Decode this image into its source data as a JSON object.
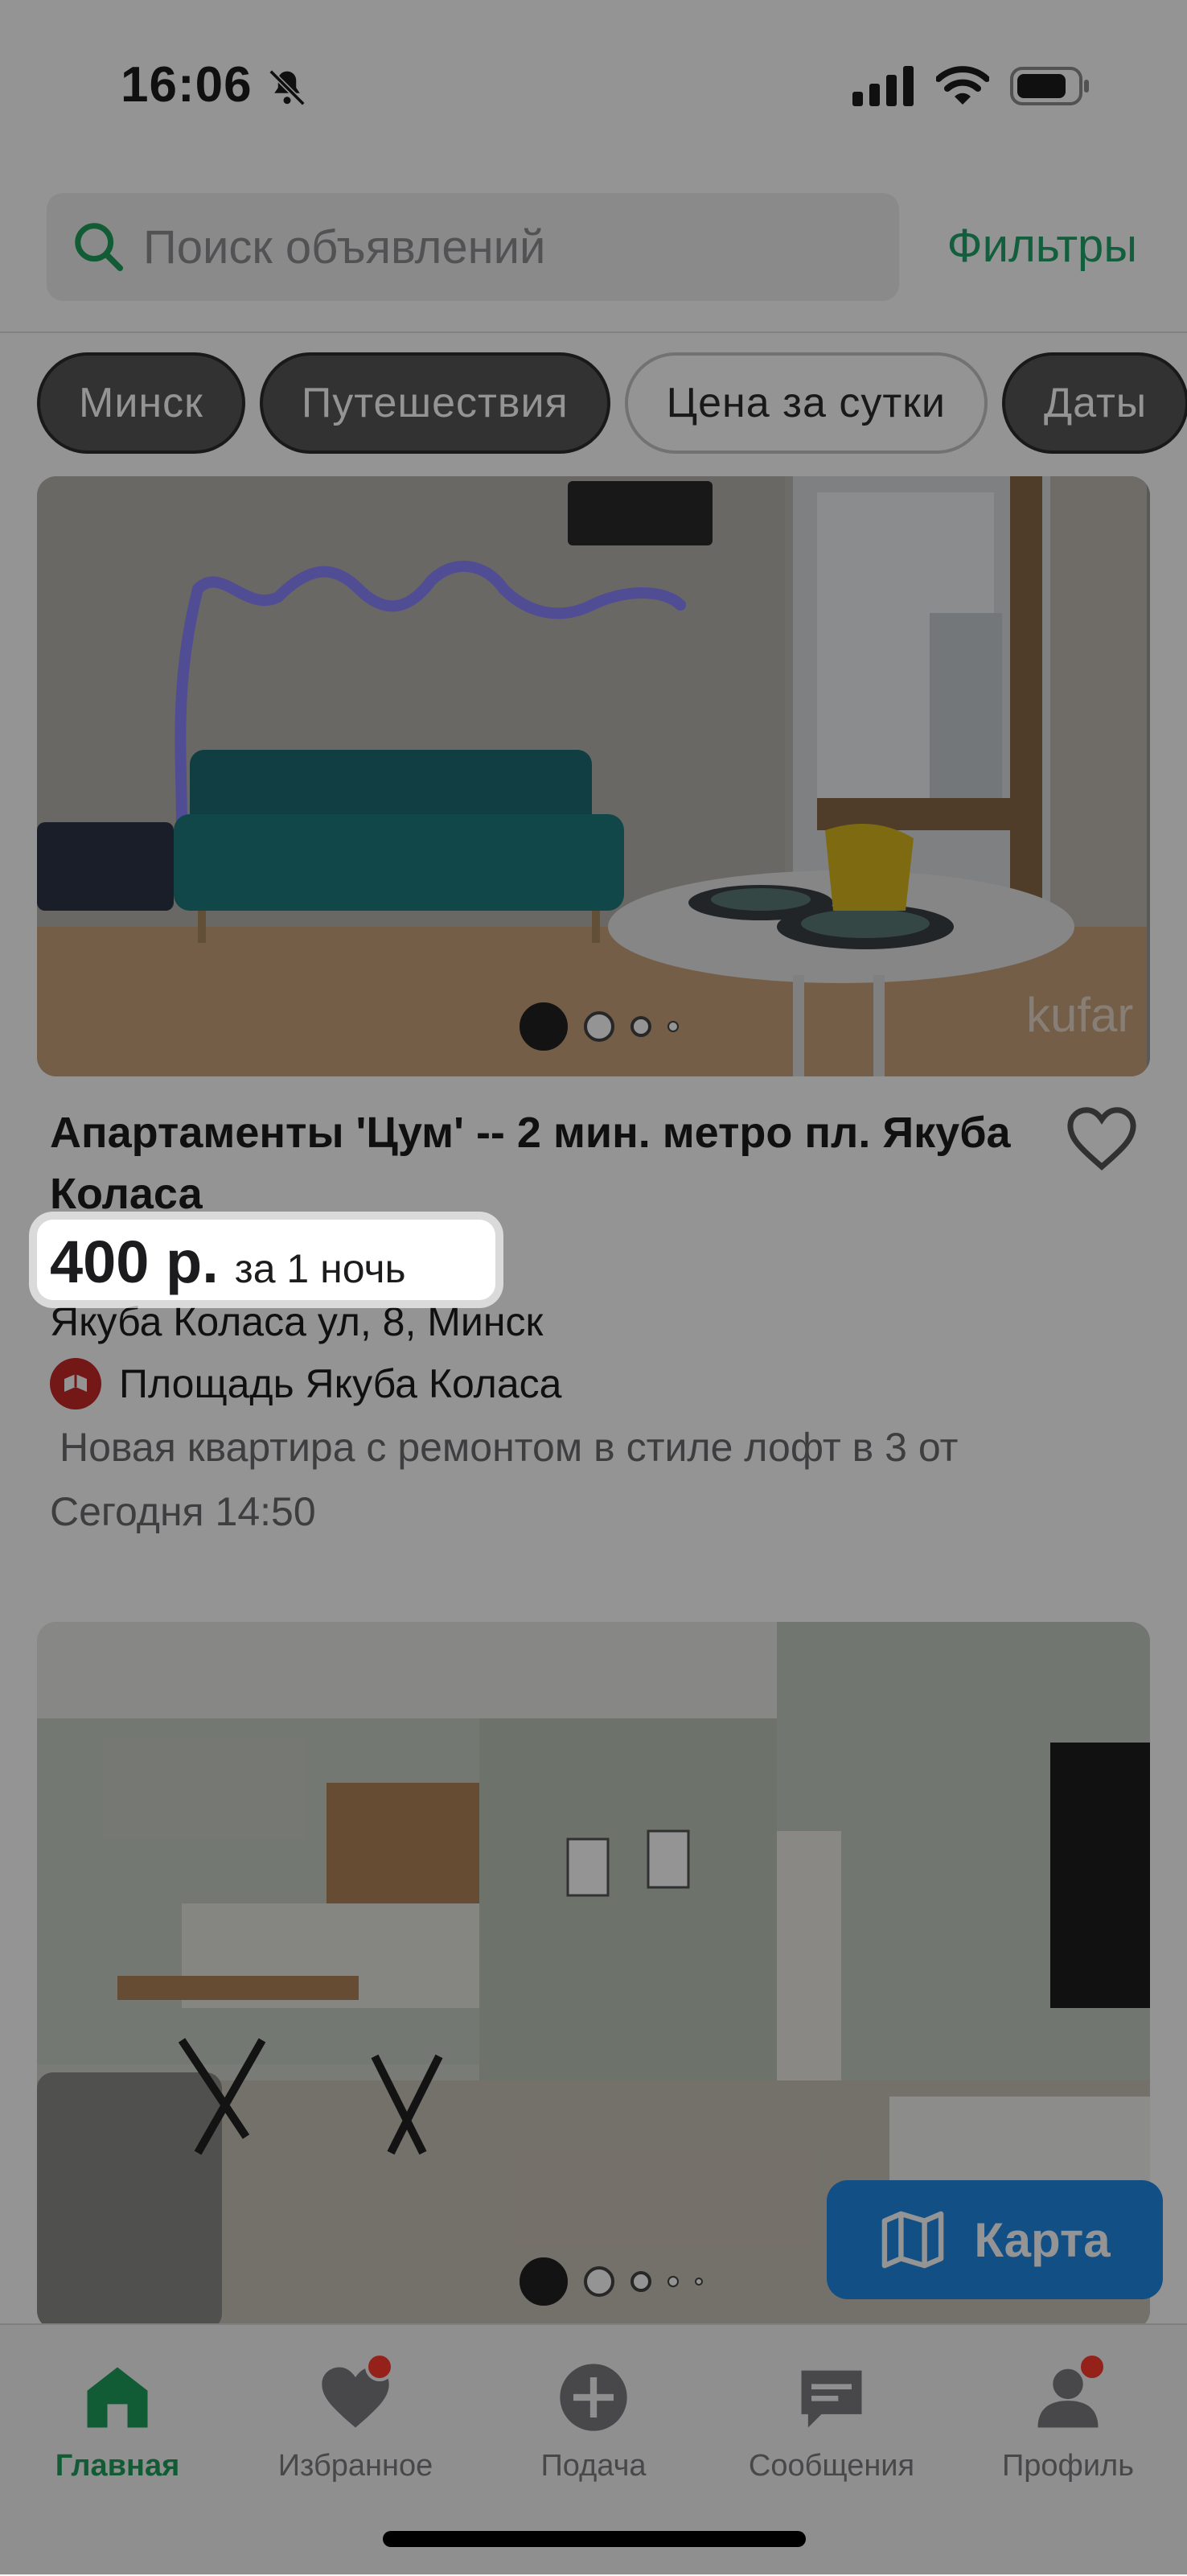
{
  "status_bar": {
    "time": "16:06"
  },
  "search": {
    "placeholder": "Поиск объявлений",
    "filters_label": "Фильтры"
  },
  "chips": [
    {
      "label": "Минск",
      "style": "dark"
    },
    {
      "label": "Путешествия",
      "style": "dark"
    },
    {
      "label": "Цена за сутки",
      "style": "light"
    },
    {
      "label": "Даты",
      "style": "dark"
    }
  ],
  "listings": [
    {
      "title": "Апартаменты 'Цум' -- 2 мин. метро пл. Якуба Коласа",
      "price": "400 р.",
      "price_unit": "за 1 ночь",
      "address": "Якуба Коласа ул, 8, Минск",
      "metro": "Площадь Якуба Коласа",
      "description": "Новая квартира с ремонтом в стиле лофт в 3 от",
      "date": "Сегодня 14:50",
      "watermark": "kufar",
      "photo_index": 1,
      "photo_count": 5
    },
    {
      "photo_index": 1,
      "photo_count": 5
    }
  ],
  "map_button": {
    "label": "Карта",
    "icon": "map-icon"
  },
  "tabs": [
    {
      "label": "Главная",
      "icon": "home-icon",
      "active": true,
      "badge": false
    },
    {
      "label": "Избранное",
      "icon": "heart-icon",
      "active": false,
      "badge": true
    },
    {
      "label": "Подача",
      "icon": "plus-circle-icon",
      "active": false,
      "badge": false
    },
    {
      "label": "Сообщения",
      "icon": "chat-icon",
      "active": false,
      "badge": false
    },
    {
      "label": "Профиль",
      "icon": "profile-icon",
      "active": false,
      "badge": true
    }
  ],
  "colors": {
    "accent_green": "#1e9e5c",
    "map_blue": "#1e88e5",
    "badge_red": "#ff3b30",
    "metro_red": "#c62828"
  }
}
